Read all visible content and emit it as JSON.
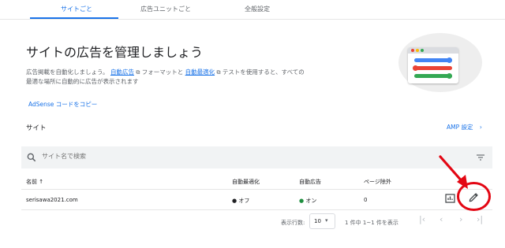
{
  "tabs": [
    {
      "label": "サイトごと",
      "active": true
    },
    {
      "label": "広告ユニットごと",
      "active": false
    },
    {
      "label": "全般設定",
      "active": false
    }
  ],
  "hero": {
    "title": "サイトの広告を管理しましょう",
    "desc_part1": "広告掲載を自動化しましょう。",
    "link_auto_ads": "自動広告",
    "desc_part2": "フォーマットと",
    "link_auto_opt": "自動最適化",
    "desc_part3": "テストを使用すると、すべての最適な場所に自動的に広告が表示されます",
    "copy_code": "AdSense コードをコピー"
  },
  "sites": {
    "label": "サイト",
    "amp_link": "AMP 設定"
  },
  "search": {
    "placeholder": "サイト名で検索"
  },
  "table": {
    "headers": {
      "name": "名前 ↑",
      "auto_opt": "自動最適化",
      "auto_ads": "自動広告",
      "page_excl": "ページ除外"
    },
    "rows": [
      {
        "name": "serisawa2021.com",
        "auto_opt": "● オフ",
        "auto_ads_dot": "●",
        "auto_ads": " オン",
        "page_excl": "0"
      }
    ]
  },
  "pager": {
    "rows_label": "表示行数:",
    "rows_value": "10",
    "range": "1 件中 1~1 件を表示"
  },
  "colors": {
    "accent": "#1a73e8",
    "annotation": "#e30613",
    "on_green": "#1e8e3e"
  }
}
